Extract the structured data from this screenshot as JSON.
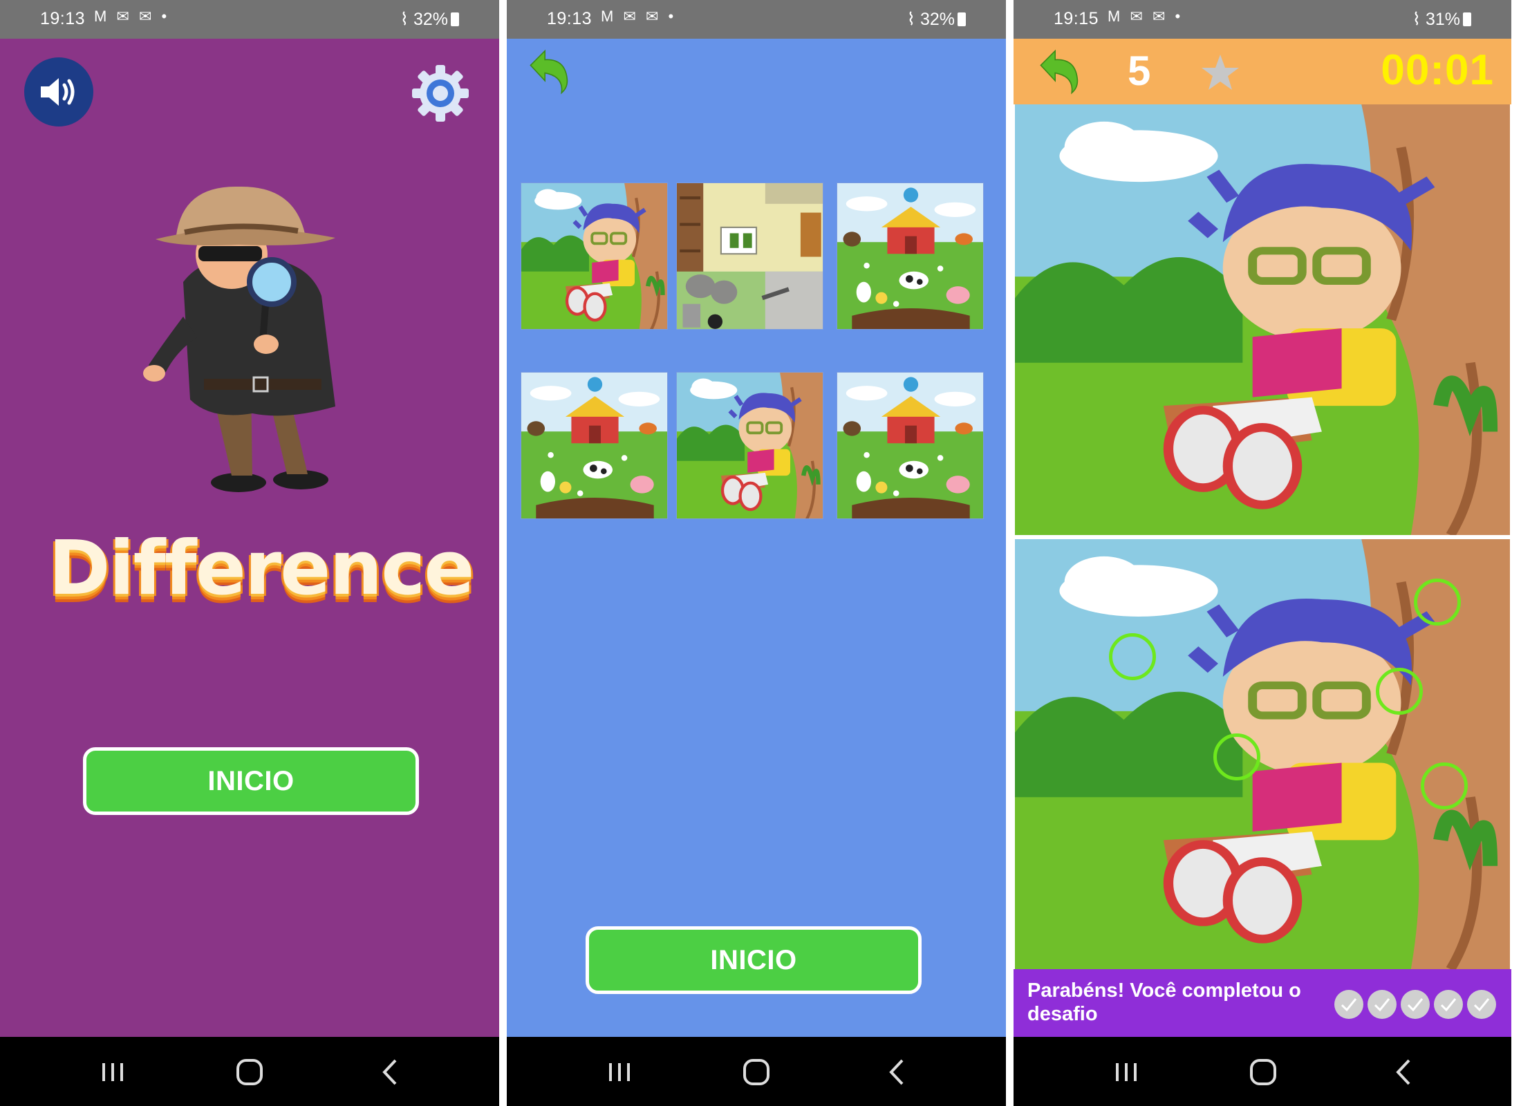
{
  "screens": [
    {
      "statusbar": {
        "time": "19:13",
        "notifications": "M ✉ ✉ •",
        "signal": "32%"
      },
      "sound_icon": "speaker-icon",
      "settings_icon": "gear-icon",
      "logo_text": "Difference",
      "start_label": "INICIO"
    },
    {
      "statusbar": {
        "time": "19:13",
        "notifications": "M ✉ ✉ •",
        "signal": "32%"
      },
      "back_icon": "back-arrow-icon",
      "thumbnails": [
        "boy-reading",
        "house-yard",
        "farm",
        "farm",
        "boy-reading",
        "farm"
      ],
      "start_label": "INICIO"
    },
    {
      "statusbar": {
        "time": "19:15",
        "notifications": "M ✉ ✉ •",
        "signal": "31%"
      },
      "back_icon": "back-arrow-icon",
      "level": "5",
      "star_icon": "star-icon",
      "timer": "00:01",
      "found_count": 5,
      "message": "Parabéns! Você completou o desafio"
    }
  ],
  "navbar": [
    "recent-apps-icon",
    "home-icon",
    "back-icon"
  ],
  "colors": {
    "menu_bg": "#8a3587",
    "level_bg": "#6693e9",
    "button": "#4ccf44",
    "topbar": "#f7b05b",
    "timer": "#fff200",
    "message_bar": "#8f2ed8",
    "found_circle": "#6ee81d"
  }
}
